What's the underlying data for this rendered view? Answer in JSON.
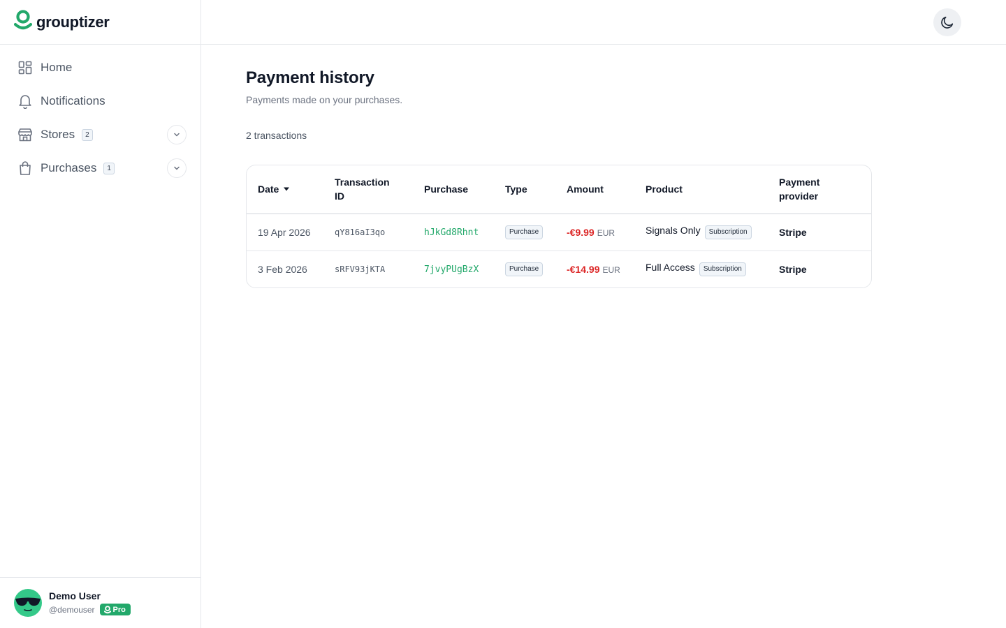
{
  "brand": {
    "name": "grouptizer",
    "accent": "#22a86a"
  },
  "sidebar": {
    "items": [
      {
        "label": "Home",
        "icon": "grid-icon"
      },
      {
        "label": "Notifications",
        "icon": "bell-icon"
      },
      {
        "label": "Stores",
        "icon": "store-icon",
        "count": "2",
        "expandable": true
      },
      {
        "label": "Purchases",
        "icon": "bag-icon",
        "count": "1",
        "expandable": true
      }
    ]
  },
  "user": {
    "name": "Demo User",
    "handle": "@demouser",
    "plan": "Pro"
  },
  "topbar": {
    "theme_toggle_icon": "moon-icon"
  },
  "page": {
    "title": "Payment history",
    "subtitle": "Payments made on your purchases.",
    "count_text": "2 transactions"
  },
  "table": {
    "columns": [
      "Date",
      "Transaction ID",
      "Purchase",
      "Type",
      "Amount",
      "Product",
      "Payment provider"
    ],
    "sorted_by": "Date",
    "rows": [
      {
        "date": "19 Apr 2026",
        "transaction_id": "qY816aI3qo",
        "purchase": "hJkGd8Rhnt",
        "type": "Purchase",
        "amount": "-€9.99",
        "currency": "EUR",
        "product": "Signals Only",
        "product_tag": "Subscription",
        "provider": "Stripe"
      },
      {
        "date": "3 Feb 2026",
        "transaction_id": "sRFV93jKTA",
        "purchase": "7jvyPUgBzX",
        "type": "Purchase",
        "amount": "-€14.99",
        "currency": "EUR",
        "product": "Full Access",
        "product_tag": "Subscription",
        "provider": "Stripe"
      }
    ]
  }
}
